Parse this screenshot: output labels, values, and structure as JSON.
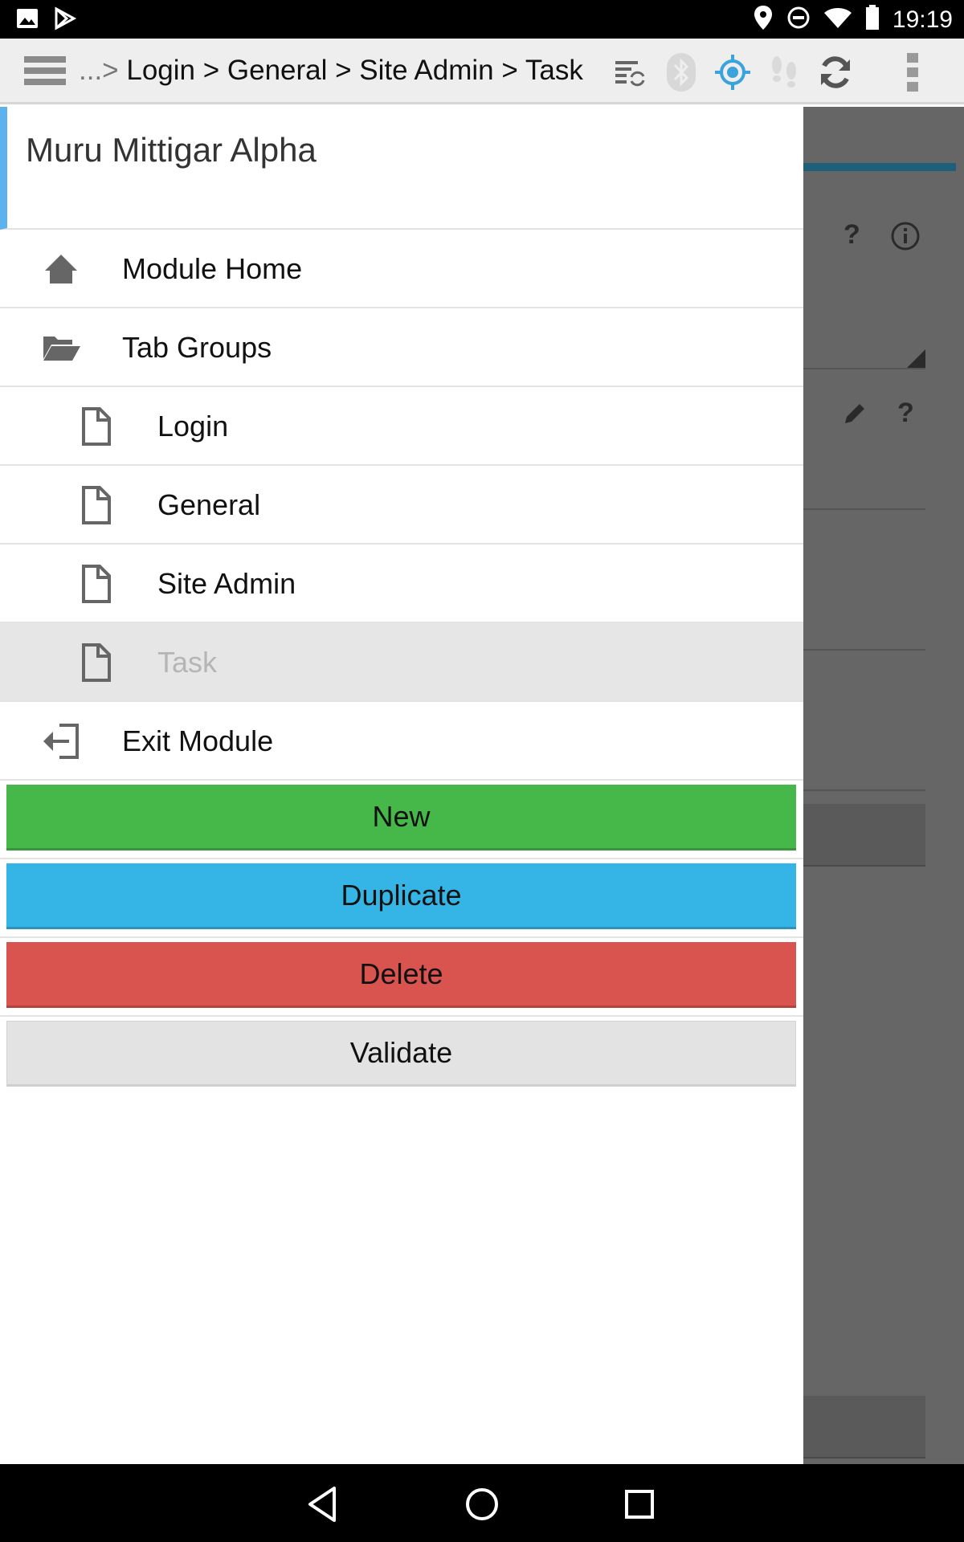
{
  "status_bar": {
    "time": "19:19",
    "icons": [
      "image-icon",
      "play-store-icon",
      "location-icon",
      "do-not-disturb-icon",
      "wifi-icon",
      "battery-icon"
    ]
  },
  "action_bar": {
    "breadcrumb_prefix": "...>",
    "breadcrumb": "Login > General > Site Admin > Task",
    "icons": [
      "sync-list-icon",
      "bluetooth-icon",
      "gps-icon",
      "footsteps-icon",
      "refresh-icon",
      "overflow-menu-icon"
    ],
    "accent_color": "#3aa3dc"
  },
  "drawer": {
    "title": "Muru Mittigar Alpha",
    "items": [
      {
        "label": "Module Home",
        "icon": "home-icon"
      },
      {
        "label": "Tab Groups",
        "icon": "folder-open-icon"
      },
      {
        "label": "Login",
        "icon": "file-icon"
      },
      {
        "label": "General",
        "icon": "file-icon"
      },
      {
        "label": "Site Admin",
        "icon": "file-icon"
      },
      {
        "label": "Task",
        "icon": "file-icon",
        "active": true
      },
      {
        "label": "Exit Module",
        "icon": "exit-icon"
      }
    ],
    "buttons": {
      "new": "New",
      "duplicate": "Duplicate",
      "delete": "Delete",
      "validate": "Validate"
    }
  },
  "colors": {
    "new": "#46b84a",
    "duplicate": "#35b5e6",
    "delete": "#d9534f",
    "validate": "#e3e3e3",
    "header_accent": "#5cb2ef"
  },
  "nav_bar": {
    "icons": [
      "back-icon",
      "home-circle-icon",
      "recents-icon"
    ]
  }
}
